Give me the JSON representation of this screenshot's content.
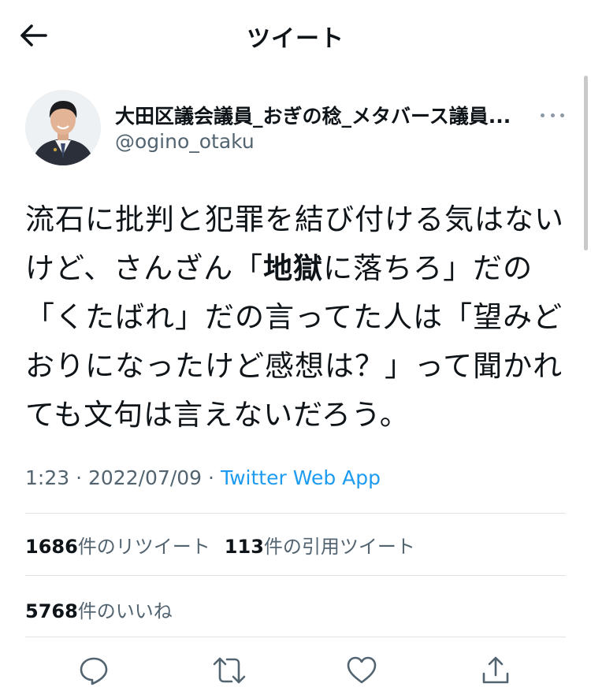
{
  "header": {
    "title": "ツイート"
  },
  "author": {
    "display_name": "大田区議会議員_おぎの稔_メタバース議員...",
    "handle": "@ogino_otaku"
  },
  "tweet": {
    "text_part1": "流石に批判と犯罪を結び付ける気はないけど、さんざん「",
    "text_bold": "地獄",
    "text_part2": "に落ちろ」だの「くたばれ」だの言ってた人は「望みどおりになったけど感想は？」って聞かれても文句は言えないだろう。"
  },
  "meta": {
    "time": "1:23",
    "separator": "·",
    "date": "2022/07/09",
    "source": "Twitter Web App"
  },
  "stats": {
    "retweets_count": "1686",
    "retweets_label": "件のリツイート",
    "quotes_count": "113",
    "quotes_label": "件の引用ツイート",
    "likes_count": "5768",
    "likes_label": "件のいいね"
  },
  "icons": {
    "back": "arrow-left-icon",
    "more": "more-horizontal-icon",
    "reply": "reply-icon",
    "retweet": "retweet-icon",
    "like": "heart-icon",
    "share": "share-icon"
  },
  "colors": {
    "text": "#0f1419",
    "secondary": "#536471",
    "link": "#1d9bf0",
    "divider": "#dfe3e6",
    "icon": "#536471"
  }
}
